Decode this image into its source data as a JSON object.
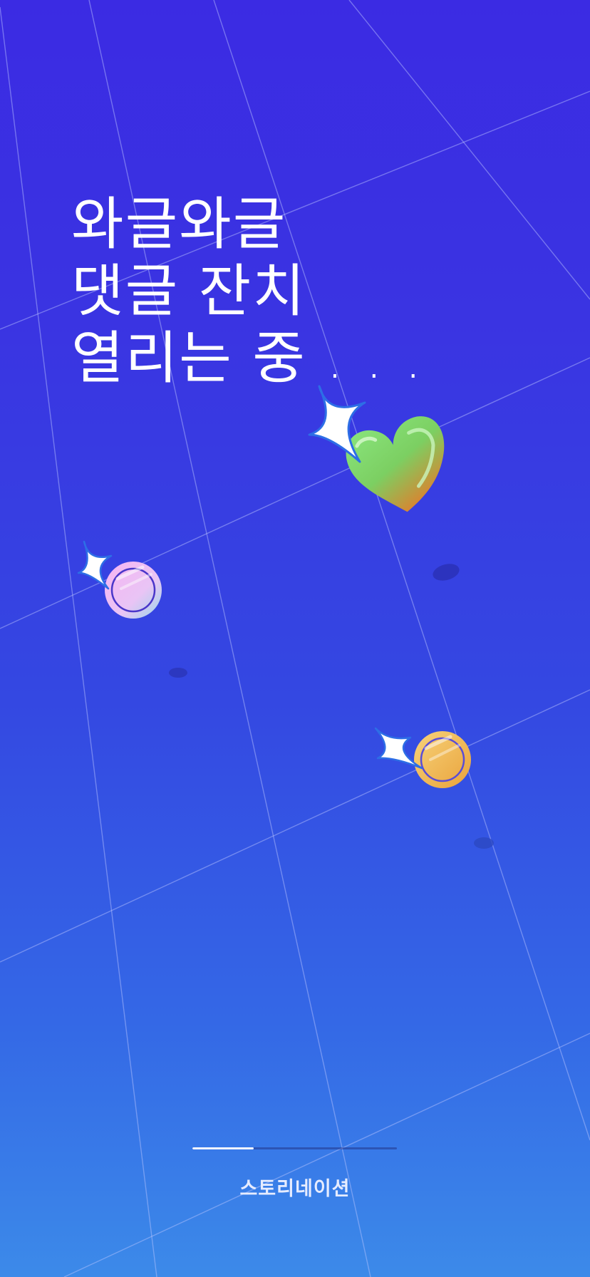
{
  "splash": {
    "headline_lines": [
      "와글와글",
      "댓글 잔치",
      "열리는 중 . . ."
    ],
    "loading_progress": 0.3,
    "brand_name": "스토리네이션"
  },
  "decorations": {
    "heart": "heart-icon",
    "sparkles": [
      "sparkle-icon",
      "sparkle-icon",
      "sparkle-icon"
    ],
    "coins": [
      "coin-icon-pink",
      "coin-icon-gold"
    ]
  },
  "colors": {
    "background_top": "#3b2be3",
    "background_bottom": "#3c8ae9",
    "heart_green": "#7fe07a",
    "heart_orange": "#e0812c",
    "coin_gold": "#f0b848",
    "coin_pink": "#f3b8f0",
    "text": "#ffffff"
  }
}
